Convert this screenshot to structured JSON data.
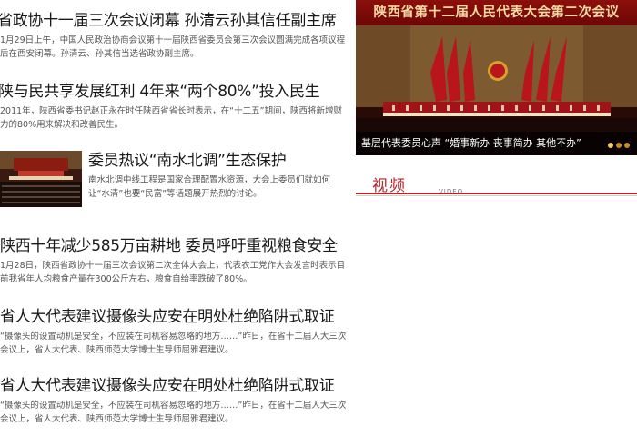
{
  "articles": [
    {
      "title": "省政协十一届三次会议闭幕 孙清云孙其信任副主席",
      "summary": "1月29日上午，中国人民政治协商会议第十一届陕西省委员会第三次会议圆满完成各项议程后在西安闭幕。孙清云、孙其信当选省政协副主席。"
    },
    {
      "title": "陕与民共享发展红利 4年来“两个80%”投入民生",
      "summary": "2011年，陕西省委书记赵正永在时任陕西省省长时表示，在“十二五”期间，陕西将新增财力的80%用来解决和改善民生。"
    },
    {
      "title": "委员热议“南水北调”生态保护",
      "summary": "南水北调中线工程是国家合理配置水资源，大会上委员们就如何让“水清”也要“民富”等话题展开热烈的讨论。"
    },
    {
      "title": "陕西十年减少585万亩耕地 委员呼吁重视粮食安全",
      "summary": "1月28日，陕西省政协十一届三次会议第二次全体大会上，代表农工党作大会发言时表示目前我省年人均粮食产量在300公斤左右，粮食自给率跌破了80%。"
    },
    {
      "title": "省人大代表建议摄像头应安在明处杜绝陷阱式取证",
      "summary": "“摄像头的设置动机是安全，不应装在司机容易忽略的地方……”昨日，在省十二届人大三次会议上，省人大代表、陕西师范大学博士生导师屈雅君建议。"
    },
    {
      "title": "省人大代表建议摄像头应安在明处杜绝陷阱式取证",
      "summary": "“摄像头的设置动机是安全，不应装在司机容易忽略的地方……”昨日，在省十二届人大三次会议上，省人大代表、陕西师范大学博士生导师屈雅君建议。"
    }
  ],
  "feature": {
    "banner": "陕西省第十二届人民代表大会第二次会议",
    "caption": "基层代表委员心声 “婚事新办 丧事简办 其他不办”"
  },
  "video": {
    "title_cn": "视频",
    "title_en": "VIDEO"
  },
  "colors": {
    "accent": "#b5242b",
    "banner": "#8c0f0b"
  }
}
